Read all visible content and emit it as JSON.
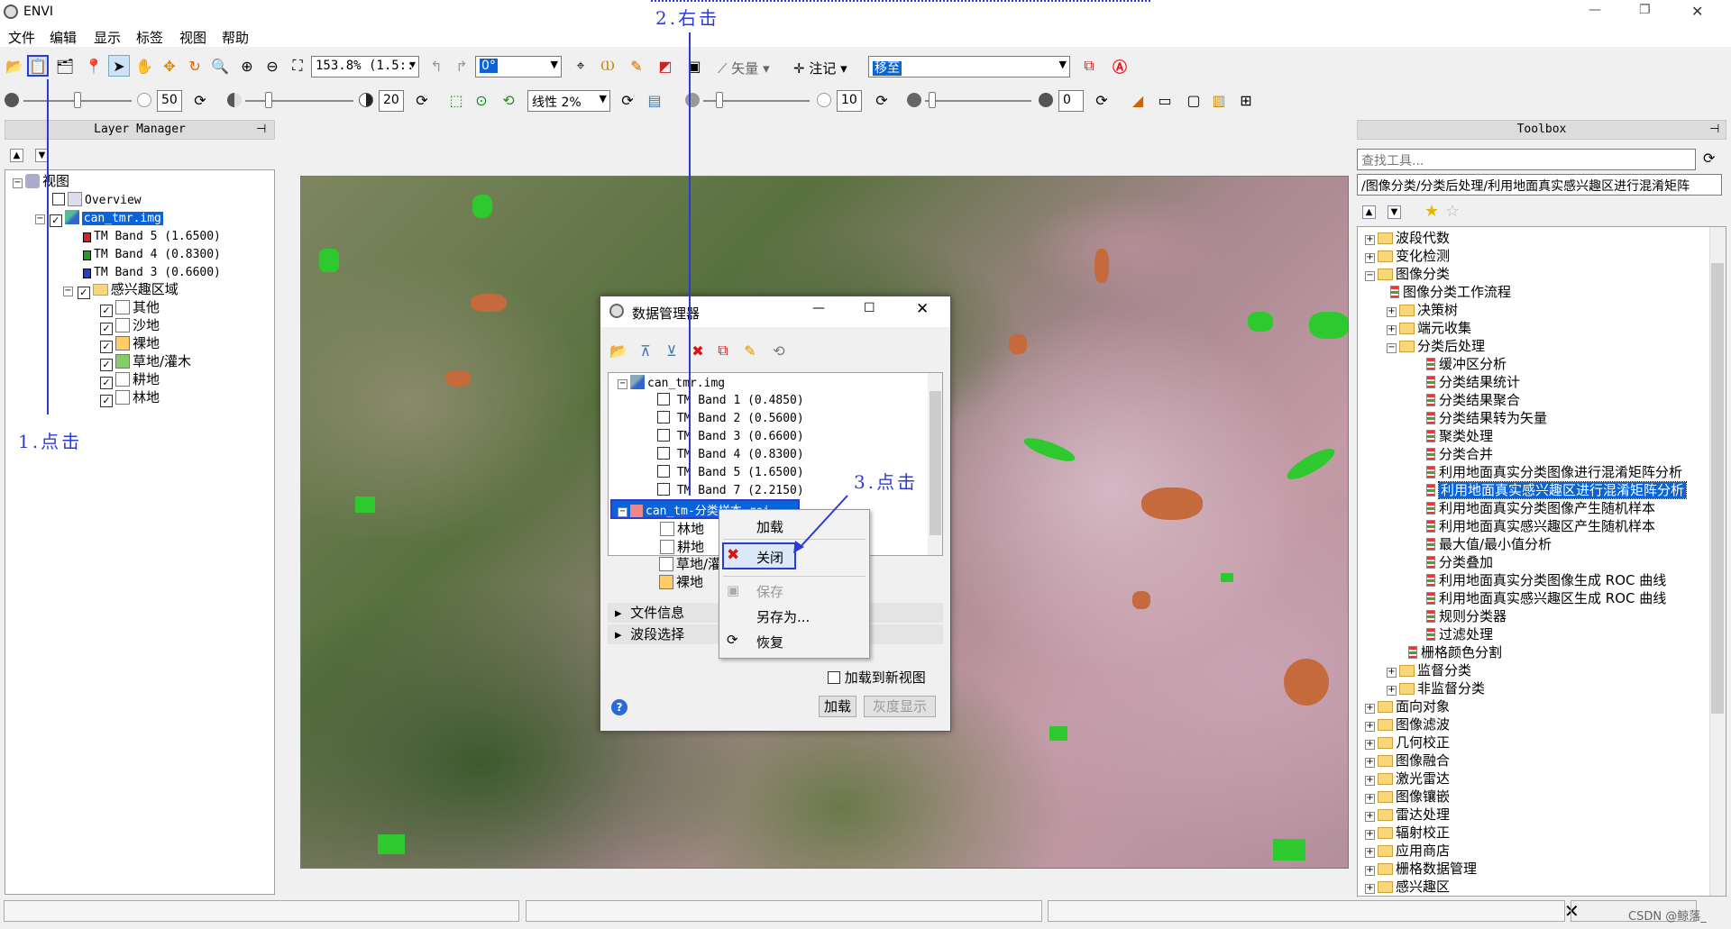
{
  "window": {
    "title": "ENVI",
    "controls": [
      "—",
      "❐",
      "✕"
    ]
  },
  "menu": [
    "文件",
    "编辑",
    "显示",
    "标签",
    "视图",
    "帮助"
  ],
  "toolbar": {
    "zoom": "153.8% (1.5::",
    "rotation": "0°",
    "vector_label": "矢量",
    "annotation_label": "注记",
    "goto": "移至"
  },
  "toolbar2": {
    "brightness": "50",
    "contrast": "20",
    "stretch": "线性 2%",
    "sharpen": "10",
    "transparency": "0"
  },
  "layer_manager": {
    "title": "Layer Manager",
    "root": "视图",
    "overview": "Overview",
    "image": "can_tmr.img",
    "bands": [
      "TM Band 5 (1.6500)",
      "TM Band 4 (0.8300)",
      "TM Band 3 (0.6600)"
    ],
    "band_colors": [
      "#e02020",
      "#20a020",
      "#2040d0"
    ],
    "roi_group": "感兴趣区域",
    "rois": [
      "其他",
      "沙地",
      "裸地",
      "草地/灌木",
      "耕地",
      "林地"
    ]
  },
  "toolbox": {
    "title": "Toolbox",
    "search_placeholder": "查找工具...",
    "path": "/图像分类/分类后处理/利用地面真实感兴趣区进行混淆矩阵",
    "top": [
      "波段代数",
      "变化检测",
      "图像分类"
    ],
    "classification": [
      "图像分类工作流程",
      "决策树",
      "端元收集",
      "分类后处理"
    ],
    "post": [
      "缓冲区分析",
      "分类结果统计",
      "分类结果聚合",
      "分类结果转为矢量",
      "聚类处理",
      "分类合并",
      "利用地面真实分类图像进行混淆矩阵分析",
      "利用地面真实感兴趣区进行混淆矩阵分析",
      "利用地面真实分类图像产生随机样本",
      "利用地面真实感兴趣区产生随机样本",
      "最大值/最小值分析",
      "分类叠加",
      "利用地面真实分类图像生成 ROC 曲线",
      "利用地面真实感兴趣区生成 ROC 曲线",
      "规则分类器",
      "过滤处理"
    ],
    "after_post": [
      "栅格颜色分割",
      "监督分类",
      "非监督分类"
    ],
    "rest": [
      "面向对象",
      "图像滤波",
      "几何校正",
      "图像融合",
      "激光雷达",
      "图像镶嵌",
      "雷达处理",
      "辐射校正",
      "应用商店",
      "栅格数据管理",
      "感兴趣区"
    ]
  },
  "data_manager": {
    "title": "数据管理器",
    "file": "can_tmr.img",
    "bands": [
      "TM Band 1 (0.4850)",
      "TM Band 2 (0.5600)",
      "TM Band 3 (0.6600)",
      "TM Band 4 (0.8300)",
      "TM Band 5 (1.6500)",
      "TM Band 7 (2.2150)"
    ],
    "roi_file": "can_tm-分类样本.roi",
    "rois": [
      "林地",
      "耕地",
      "草地/灌",
      "裸地"
    ],
    "sections": [
      "文件信息",
      "波段选择"
    ],
    "load_new_view": "加载到新视图",
    "load_button": "加载",
    "gray_button": "灰度显示"
  },
  "context_menu": [
    "加载",
    "关闭",
    "保存",
    "另存为...",
    "恢复"
  ],
  "annotations": [
    "1.点击",
    "2.右击",
    "3.点击"
  ],
  "watermark": "CSDN @鲸落_"
}
